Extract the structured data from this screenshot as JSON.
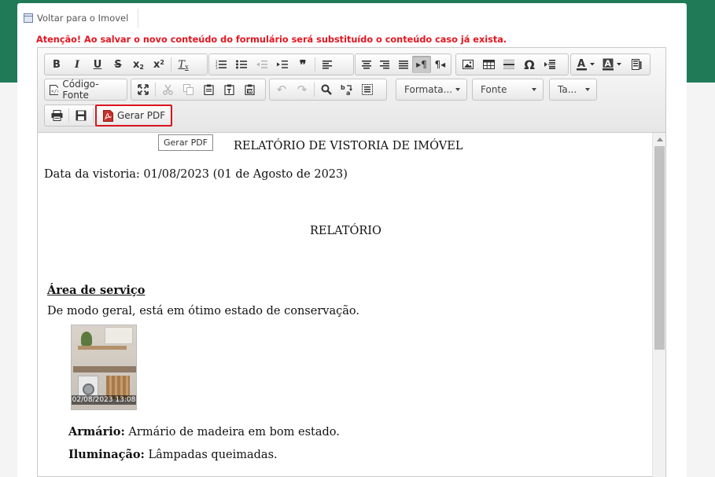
{
  "nav": {
    "back_label": "Voltar para o Imovel"
  },
  "warning": "Atenção! Ao salvar o novo conteúdo do formulário será substituído o conteúdo caso já exista.",
  "toolbar": {
    "source_label": "Código-Fonte",
    "format_combo": "Formata...",
    "font_combo": "Fonte",
    "size_combo": "Ta...",
    "generate_pdf_label": "Gerar PDF",
    "tooltip": "Gerar PDF",
    "icons": [
      "bold-icon",
      "italic-icon",
      "underline-icon",
      "strike-icon",
      "subscript-icon",
      "superscript-icon",
      "remove-format-icon",
      "numbered-list-icon",
      "bulleted-list-icon",
      "outdent-icon",
      "indent-icon",
      "blockquote-icon",
      "align-left-icon",
      "align-center-icon",
      "align-right-icon",
      "justify-icon",
      "ltr-icon",
      "rtl-icon",
      "image-icon",
      "table-icon",
      "horizontal-line-icon",
      "special-char-icon",
      "page-break-icon",
      "text-color-icon",
      "background-color-icon",
      "maximize-icon",
      "cut-icon",
      "copy-icon",
      "paste-icon",
      "paste-text-icon",
      "paste-word-icon",
      "undo-icon",
      "redo-icon",
      "find-icon",
      "replace-icon",
      "select-all-icon",
      "print-icon",
      "save-icon",
      "pdf-icon"
    ]
  },
  "document": {
    "title": "RELATÓRIO DE VISTORIA DE IMÓVEL",
    "date_line": "Data da vistoria: 01/08/2023 (01 de Agosto de 2023)",
    "section_title": "RELATÓRIO",
    "area_title": "Área de serviço",
    "area_summary": "De modo geral, está em ótimo estado de conservação.",
    "photo_timestamp": "02/08/2023 13:08",
    "items": [
      {
        "label": "Armário:",
        "text": " Armário de madeira em bom estado."
      },
      {
        "label": "Iluminação:",
        "text": " Lâmpadas queimadas."
      }
    ]
  },
  "colors": {
    "brand_green": "#217a57",
    "warning_red": "#e5141e",
    "highlight_red": "#d9141e"
  }
}
